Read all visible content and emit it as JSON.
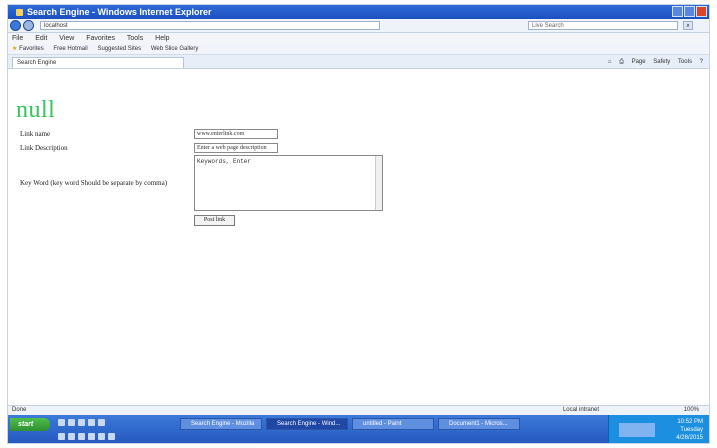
{
  "window": {
    "title": "Search Engine - Windows Internet Explorer"
  },
  "address_bar": {
    "url": "localhost",
    "search_placeholder": "Live Search"
  },
  "menu": [
    "File",
    "Edit",
    "View",
    "Favorites",
    "Tools",
    "Help"
  ],
  "favorites": {
    "label": "Favorites",
    "items": [
      "Free Hotmail",
      "Suggested Sites",
      "Web Slice Gallery"
    ]
  },
  "tab": {
    "title": "Search Engine"
  },
  "command_bar": [
    "Page",
    "Safety",
    "Tools"
  ],
  "page": {
    "heading": "null",
    "link_name_label": "Link name",
    "link_name_value": "www.enterlink.com",
    "link_description_label": "Link Description",
    "link_description_value": "Enter a web page description",
    "keywords_label": "Key Word (key word Should be separate by comma)",
    "keywords_value": "Keywords, Enter",
    "submit_label": "Post link"
  },
  "status_bar": {
    "left": "Done",
    "zone": "Local intranet",
    "zoom": "100%"
  },
  "taskbar": {
    "start_label": "start",
    "tasks": [
      "Search Engine - Mozilla",
      "Search Engine - Wind...",
      "untitled - Paint",
      "Document1 - Micros..."
    ],
    "clock": [
      "10:52 PM",
      "Tuesday",
      "4/28/2015"
    ]
  }
}
